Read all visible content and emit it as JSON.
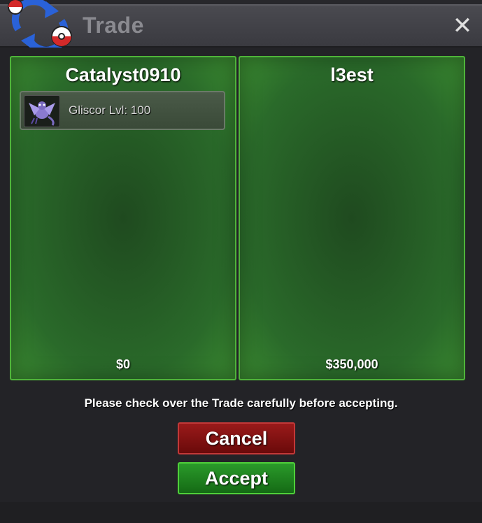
{
  "window": {
    "title": "Trade",
    "close_label": "✕"
  },
  "left_panel": {
    "player_name": "Catalyst0910",
    "money": "$0",
    "items": [
      {
        "label": "Gliscor  Lvl: 100",
        "icon": "gliscor-sprite"
      }
    ]
  },
  "right_panel": {
    "player_name": "l3est",
    "money": "$350,000",
    "items": []
  },
  "notice": "Please check over the Trade carefully before accepting.",
  "buttons": {
    "cancel": "Cancel",
    "accept": "Accept"
  },
  "colors": {
    "panel_border": "#4fb43a",
    "cancel_bg": "#8a1414",
    "accept_bg": "#1f851f"
  }
}
